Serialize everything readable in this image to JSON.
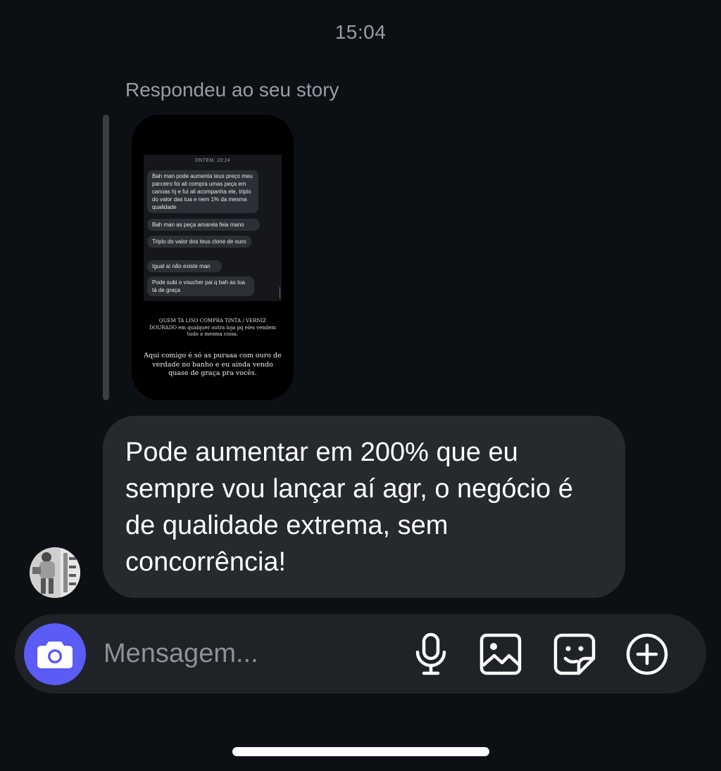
{
  "timestamp": "15:04",
  "reply_label": "Respondeu ao seu story",
  "story": {
    "time": "ONTEM, 20:24",
    "messages": [
      "Bah man pode aumenta teus preço meu parceiro foi ali compra umas peça em canoas hj e fui ali acompanha ele, triplo do valor das tua e nem 1% da mesma qualidade",
      "Bah man as peça amarela feia mano",
      "Triplo do valor dos teus clone de ouro",
      "Igual aí não existe man",
      "Pode subi o voucher pai q bah as tua tá de graça"
    ],
    "caption1": "QUEM TA LISO COMPRA TINTA / VERNIZ DOURADO em qualquer outra loja pq eles vendem tudo a mesma coisa.",
    "caption2": "Aqui comigo é só as puraaa com ouro de verdade no banho e eu ainda vendo quase de graça pra vocês."
  },
  "message": {
    "text": "Pode aumentar em 200% que eu sempre vou lançar aí agr, o negócio é de qualidade extrema, sem concorrência!"
  },
  "composer": {
    "placeholder": "Mensagem...",
    "camera_icon": "camera-icon",
    "icons": [
      "microphone-icon",
      "image-icon",
      "sticker-icon",
      "plus-circle-icon"
    ]
  },
  "colors": {
    "background": "#0c0f14",
    "bubble": "#26292e",
    "composer": "#1f2227",
    "accent": "#5b5bf5",
    "muted_text": "#9a9da3"
  }
}
